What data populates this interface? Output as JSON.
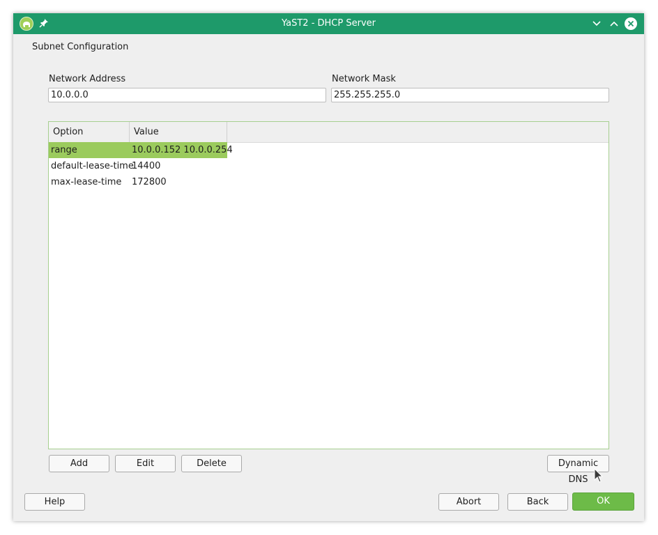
{
  "window": {
    "title": "YaST2 - DHCP Server"
  },
  "titlebar": {
    "app_icon": "yast-chameleon-icon",
    "pin_icon": "pin-icon",
    "minimize_icon": "chevron-down-icon",
    "maximize_icon": "chevron-up-icon",
    "close_icon": "close-icon"
  },
  "section": {
    "title": "Subnet Configuration"
  },
  "network_address": {
    "label": "Network Address",
    "value": "10.0.0.0"
  },
  "network_mask": {
    "label": "Network Mask",
    "value": "255.255.255.0"
  },
  "table": {
    "columns": [
      "Option",
      "Value"
    ],
    "rows": [
      {
        "option": "range",
        "value": "10.0.0.152 10.0.0.254",
        "selected": true
      },
      {
        "option": "default-lease-time",
        "value": "14400",
        "selected": false
      },
      {
        "option": "max-lease-time",
        "value": "172800",
        "selected": false
      }
    ]
  },
  "table_buttons": {
    "add": "Add",
    "edit": "Edit",
    "delete": "Delete",
    "dynamic_dns": "Dynamic DNS"
  },
  "footer_buttons": {
    "help": "Help",
    "abort": "Abort",
    "back": "Back",
    "ok": "OK"
  },
  "colors": {
    "titlebar": "#1e9a6a",
    "selection": "#9bcb5d",
    "ok_button": "#6dbb48",
    "table_border": "#a6cf8f"
  }
}
